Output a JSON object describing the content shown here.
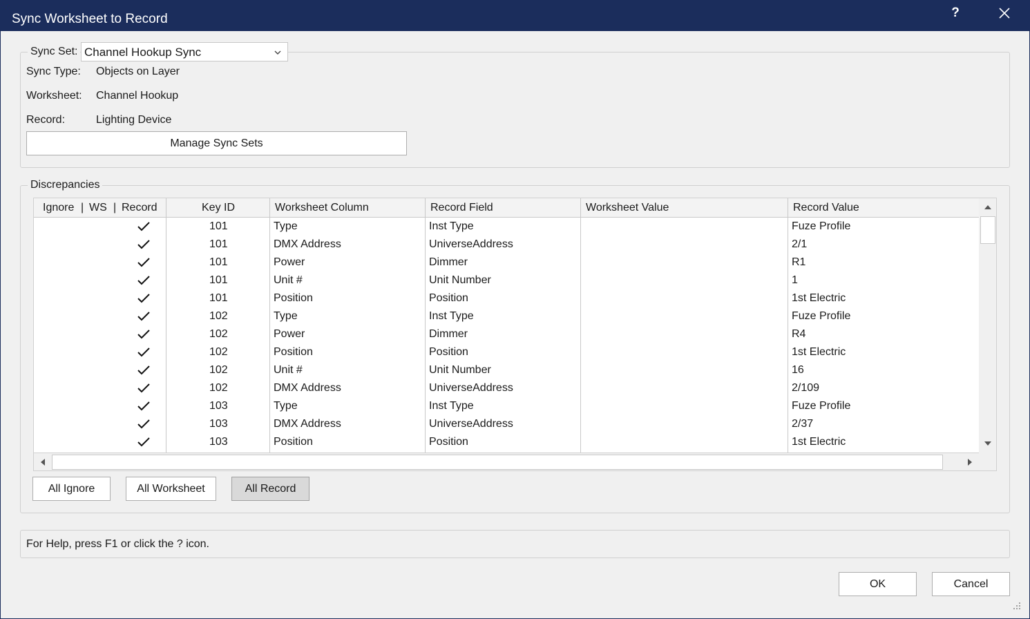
{
  "window": {
    "title": "Sync Worksheet to Record",
    "help_label": "?"
  },
  "sync": {
    "set_label": "Sync Set:",
    "set_value": "Channel Hookup Sync",
    "type_label": "Sync Type:",
    "type_value": "Objects on Layer",
    "worksheet_label": "Worksheet:",
    "worksheet_value": "Channel Hookup",
    "record_label": "Record:",
    "record_value": "Lighting Device",
    "manage_button": "Manage Sync Sets"
  },
  "discrepancies": {
    "group_label": "Discrepancies",
    "columns": {
      "ignore": "Ignore",
      "ws": "WS",
      "record": "Record",
      "separator": "|",
      "key_id": "Key ID",
      "worksheet_column": "Worksheet Column",
      "record_field": "Record Field",
      "worksheet_value": "Worksheet Value",
      "record_value": "Record Value"
    },
    "rows": [
      {
        "choice": "record",
        "key": "101",
        "ws_column": "Type",
        "rec_field": "Inst Type",
        "ws_value": "",
        "rec_value": "Fuze Profile"
      },
      {
        "choice": "record",
        "key": "101",
        "ws_column": "DMX Address",
        "rec_field": "UniverseAddress",
        "ws_value": "",
        "rec_value": "2/1"
      },
      {
        "choice": "record",
        "key": "101",
        "ws_column": "Power",
        "rec_field": "Dimmer",
        "ws_value": "",
        "rec_value": "R1"
      },
      {
        "choice": "record",
        "key": "101",
        "ws_column": "Unit #",
        "rec_field": "Unit Number",
        "ws_value": "",
        "rec_value": "1"
      },
      {
        "choice": "record",
        "key": "101",
        "ws_column": "Position",
        "rec_field": "Position",
        "ws_value": "",
        "rec_value": "1st Electric"
      },
      {
        "choice": "record",
        "key": "102",
        "ws_column": "Type",
        "rec_field": "Inst Type",
        "ws_value": "",
        "rec_value": "Fuze Profile"
      },
      {
        "choice": "record",
        "key": "102",
        "ws_column": "Power",
        "rec_field": "Dimmer",
        "ws_value": "",
        "rec_value": "R4"
      },
      {
        "choice": "record",
        "key": "102",
        "ws_column": "Position",
        "rec_field": "Position",
        "ws_value": "",
        "rec_value": "1st Electric"
      },
      {
        "choice": "record",
        "key": "102",
        "ws_column": "Unit #",
        "rec_field": "Unit Number",
        "ws_value": "",
        "rec_value": "16"
      },
      {
        "choice": "record",
        "key": "102",
        "ws_column": "DMX Address",
        "rec_field": "UniverseAddress",
        "ws_value": "",
        "rec_value": "2/109"
      },
      {
        "choice": "record",
        "key": "103",
        "ws_column": "Type",
        "rec_field": "Inst Type",
        "ws_value": "",
        "rec_value": "Fuze Profile"
      },
      {
        "choice": "record",
        "key": "103",
        "ws_column": "DMX Address",
        "rec_field": "UniverseAddress",
        "ws_value": "",
        "rec_value": "2/37"
      },
      {
        "choice": "record",
        "key": "103",
        "ws_column": "Position",
        "rec_field": "Position",
        "ws_value": "",
        "rec_value": "1st Electric"
      }
    ],
    "buttons": {
      "all_ignore": "All Ignore",
      "all_worksheet": "All Worksheet",
      "all_record": "All Record"
    }
  },
  "help_text": "For Help, press F1 or click the ? icon.",
  "footer": {
    "ok": "OK",
    "cancel": "Cancel"
  },
  "colors": {
    "titlebar": "#1b2d5c",
    "background": "#f0f0f0"
  }
}
